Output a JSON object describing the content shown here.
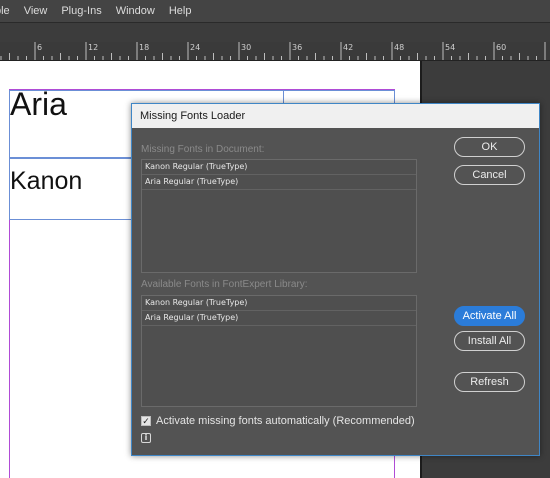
{
  "menubar": {
    "items": [
      "ble",
      "View",
      "Plug-Ins",
      "Window",
      "Help"
    ]
  },
  "ruler": {
    "labels": [
      "6",
      "12",
      "18",
      "24",
      "30",
      "36",
      "42",
      "48",
      "54",
      "60"
    ]
  },
  "document": {
    "text_aria": "Aria",
    "text_kanon": "Kanon"
  },
  "dialog": {
    "title": "Missing Fonts Loader",
    "missing_label": "Missing Fonts in Document:",
    "missing_fonts": [
      "Kanon Regular (TrueType)",
      "Aria Regular (TrueType)"
    ],
    "available_label": "Available Fonts in FontExpert Library:",
    "available_fonts": [
      "Kanon Regular (TrueType)",
      "Aria Regular (TrueType)"
    ],
    "ok_label": "OK",
    "cancel_label": "Cancel",
    "activate_all_label": "Activate All",
    "install_all_label": "Install All",
    "refresh_label": "Refresh",
    "auto_activate_label": "Activate missing fonts automatically (Recommended)",
    "auto_activate_checked": true,
    "accent_color": "#2b7cd9"
  }
}
